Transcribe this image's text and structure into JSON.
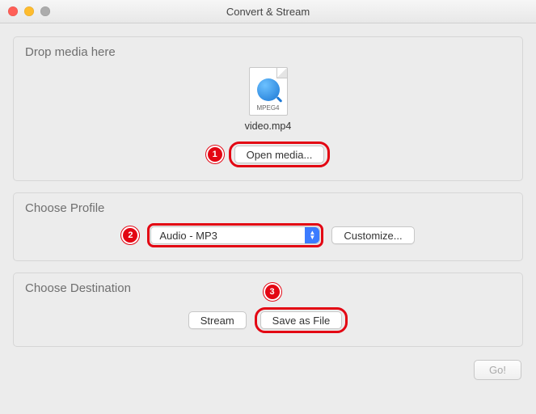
{
  "window": {
    "title": "Convert & Stream"
  },
  "drop": {
    "section_title": "Drop media here",
    "file_codec": "MPEG4",
    "file_name": "video.mp4",
    "open_media_label": "Open media..."
  },
  "profile": {
    "section_title": "Choose Profile",
    "selected": "Audio - MP3",
    "customize_label": "Customize..."
  },
  "destination": {
    "section_title": "Choose Destination",
    "stream_label": "Stream",
    "save_label": "Save as File"
  },
  "footer": {
    "go_label": "Go!"
  },
  "annotations": {
    "badge1": "1",
    "badge2": "2",
    "badge3": "3"
  }
}
